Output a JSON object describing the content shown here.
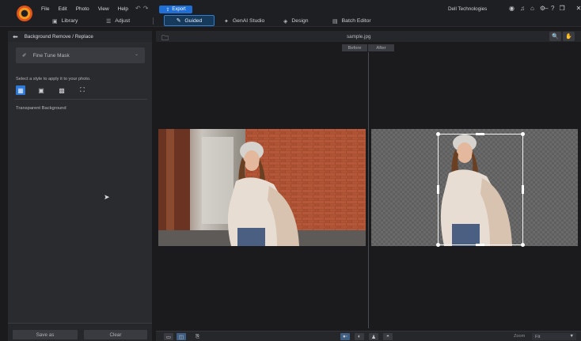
{
  "app": {
    "menu": [
      "File",
      "Edit",
      "Photo",
      "View",
      "Help"
    ],
    "export_label": "Export",
    "account": "Dell Technologies"
  },
  "nav": {
    "library_label": "Library",
    "adjust_label": "Adjust",
    "guided_label": "Guided",
    "genai_label": "GenAI Studio",
    "design_label": "Design",
    "batch_label": "Batch Editor"
  },
  "panel": {
    "title": "Background Remove / Replace",
    "fine_tune_label": "Fine Tune Mask",
    "style_hint": "Select a style to apply it to your photo.",
    "selected_style_label": "Transparent Background",
    "save_as_label": "Save as",
    "clear_label": "Clear"
  },
  "canvas": {
    "filename": "sample.jpg",
    "before_label": "Before",
    "after_label": "After"
  },
  "bottom": {
    "zoom_label": "Zoom",
    "zoom_value": "Fit"
  },
  "colors": {
    "accent": "#2e79d6",
    "export_button": "#1f6fd6",
    "guided_tab_border": "#2d7fd3"
  },
  "icons": {
    "library": "library-icon",
    "adjust": "sliders-icon",
    "guided": "wand-icon",
    "genai": "sparkle-icon",
    "design": "design-icon",
    "batch": "batch-icon"
  }
}
